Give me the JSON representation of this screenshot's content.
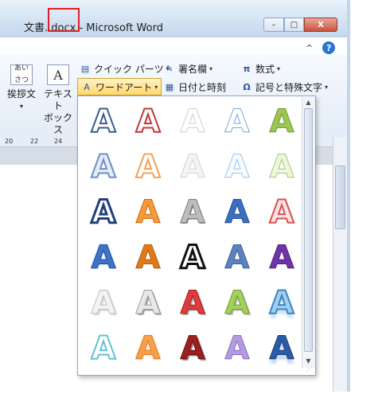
{
  "window": {
    "title": "文書..docx - Microsoft Word",
    "buttons": {
      "minimize": "–",
      "maximize": "□",
      "close": "X"
    },
    "ribbon_collapse": "^",
    "help": "?"
  },
  "ribbon": {
    "greeting": {
      "label_line1": "挨拶文",
      "icon_text": "あいさつ"
    },
    "textbox": {
      "label_line1": "テキスト",
      "label_line2": "ボックス",
      "icon_text": "A"
    },
    "quick_parts": "クイック パーツ",
    "wordart": "ワードアート",
    "signature": "署名欄",
    "datetime": "日付と時刻",
    "equation": "数式",
    "symbols": "記号と特殊文字",
    "dropdown_arrow": "▾"
  },
  "ruler": {
    "marks": [
      "20",
      "22",
      "24"
    ]
  },
  "gallery": {
    "glyph": "A",
    "styles": [
      "outline-blue",
      "fill-red-outline",
      "white-outline",
      "white-blue-outline",
      "green-gradient",
      "blue-light-outline",
      "orange-outline",
      "white-soft",
      "white-blue-soft",
      "green-soft",
      "blue-dark-outline",
      "orange-fill",
      "gray-metal",
      "blue-fill",
      "red-double-outline",
      "blue-gradient",
      "orange-bold",
      "black-white",
      "blue-steel",
      "purple-fill",
      "white-shadow",
      "gray-bevel",
      "red-bevel",
      "green-bevel",
      "blue-reflect",
      "cyan-outline",
      "orange-glow",
      "dark-red",
      "purple-soft",
      "navy-reflect"
    ]
  }
}
